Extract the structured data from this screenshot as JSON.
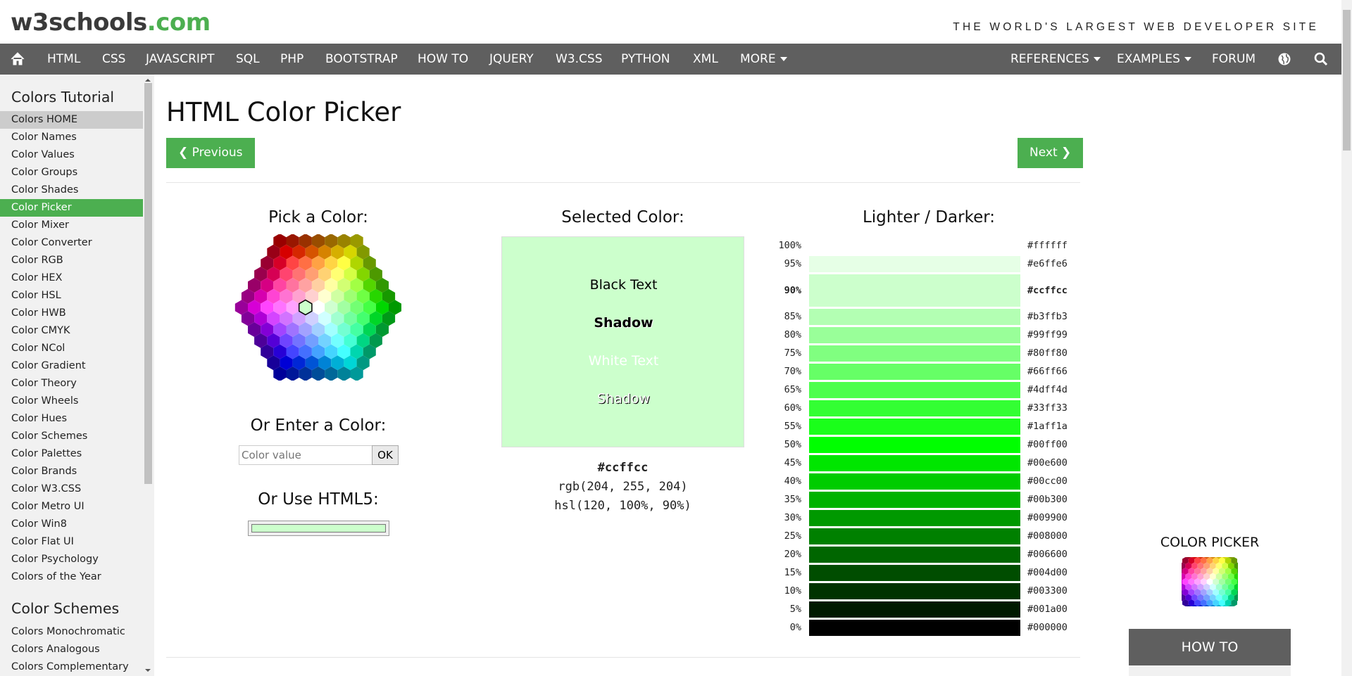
{
  "header": {
    "logo_main": "w3schools",
    "logo_suffix": ".com",
    "slogan": "THE WORLD'S LARGEST WEB DEVELOPER SITE"
  },
  "nav": {
    "items": [
      "HTML",
      "CSS",
      "JAVASCRIPT",
      "SQL",
      "PHP",
      "BOOTSTRAP",
      "HOW TO",
      "JQUERY",
      "W3.CSS",
      "PYTHON",
      "XML",
      "MORE"
    ],
    "right": [
      "REFERENCES",
      "EXAMPLES",
      "FORUM"
    ]
  },
  "sidebar": {
    "heading1": "Colors Tutorial",
    "items": [
      "Colors HOME",
      "Color Names",
      "Color Values",
      "Color Groups",
      "Color Shades",
      "Color Picker",
      "Color Mixer",
      "Color Converter",
      "Color RGB",
      "Color HEX",
      "Color HSL",
      "Color HWB",
      "Color CMYK",
      "Color NCol",
      "Color Gradient",
      "Color Theory",
      "Color Wheels",
      "Color Hues",
      "Color Schemes",
      "Color Palettes",
      "Color Brands",
      "Color W3.CSS",
      "Color Metro UI",
      "Color Win8",
      "Color Flat UI",
      "Color Psychology",
      "Colors of the Year"
    ],
    "heading2": "Color Schemes",
    "items2": [
      "Colors Monochromatic",
      "Colors Analogous",
      "Colors Complementary"
    ]
  },
  "main": {
    "title": "HTML Color Picker",
    "prev_label": "Previous",
    "next_label": "Next",
    "pick_title": "Pick a Color:",
    "enter_title": "Or Enter a Color:",
    "input_placeholder": "Color value",
    "ok_label": "OK",
    "html5_title": "Or Use HTML5:",
    "selected_title": "Selected Color:",
    "black_text": "Black Text",
    "black_shadow": "Shadow",
    "white_text": "White Text",
    "white_shadow": "Shadow",
    "hex": "#ccffcc",
    "rgb": "rgb(204, 255, 204)",
    "hsl": "hsl(120, 100%, 90%)",
    "shades_title": "Lighter / Darker:",
    "shades": [
      {
        "pct": "100%",
        "hex": "#ffffff"
      },
      {
        "pct": "95%",
        "hex": "#e6ffe6"
      },
      {
        "pct": "90%",
        "hex": "#ccffcc",
        "selected": true
      },
      {
        "pct": "85%",
        "hex": "#b3ffb3"
      },
      {
        "pct": "80%",
        "hex": "#99ff99"
      },
      {
        "pct": "75%",
        "hex": "#80ff80"
      },
      {
        "pct": "70%",
        "hex": "#66ff66"
      },
      {
        "pct": "65%",
        "hex": "#4dff4d"
      },
      {
        "pct": "60%",
        "hex": "#33ff33"
      },
      {
        "pct": "55%",
        "hex": "#1aff1a"
      },
      {
        "pct": "50%",
        "hex": "#00ff00"
      },
      {
        "pct": "45%",
        "hex": "#00e600"
      },
      {
        "pct": "40%",
        "hex": "#00cc00"
      },
      {
        "pct": "35%",
        "hex": "#00b300"
      },
      {
        "pct": "30%",
        "hex": "#009900"
      },
      {
        "pct": "25%",
        "hex": "#008000"
      },
      {
        "pct": "20%",
        "hex": "#006600"
      },
      {
        "pct": "15%",
        "hex": "#004d00"
      },
      {
        "pct": "10%",
        "hex": "#003300"
      },
      {
        "pct": "5%",
        "hex": "#001a00"
      },
      {
        "pct": "0%",
        "hex": "#000000"
      }
    ]
  },
  "right": {
    "color_picker_label": "COLOR PICKER",
    "howto_label": "HOW TO"
  },
  "colors": {
    "brand_green": "#4CAF50",
    "nav_bg": "#5f5f5f",
    "selected_color": "#ccffcc"
  }
}
